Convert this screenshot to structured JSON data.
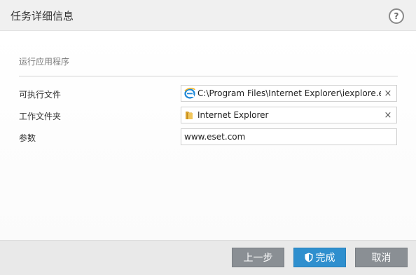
{
  "dialog": {
    "title": "任务详细信息",
    "help_label": "?"
  },
  "section": {
    "title": "运行应用程序"
  },
  "fields": {
    "executable": {
      "label": "可执行文件",
      "value": "C:\\Program Files\\Internet Explorer\\iexplore.exe",
      "icon": "internet-explorer-icon",
      "clear_label": "×"
    },
    "working_folder": {
      "label": "工作文件夹",
      "value": "Internet Explorer",
      "icon": "folder-icon",
      "clear_label": "×"
    },
    "parameters": {
      "label": "参数",
      "value": "www.eset.com"
    }
  },
  "footer": {
    "back_label": "上一步",
    "finish_label": "完成",
    "cancel_label": "取消"
  },
  "colors": {
    "accent": "#2f8fce",
    "button_gray": "#8a8f94"
  }
}
